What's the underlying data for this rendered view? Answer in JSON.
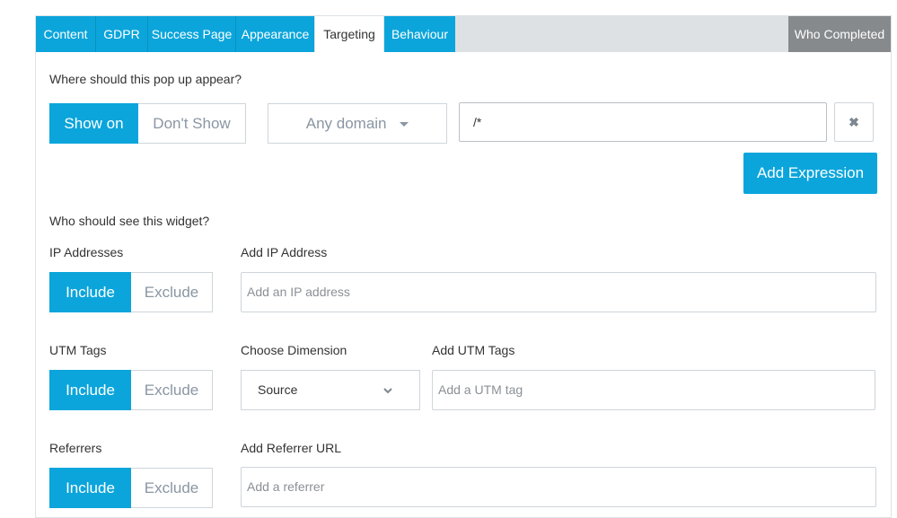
{
  "tabs": [
    {
      "label": "Content"
    },
    {
      "label": "GDPR"
    },
    {
      "label": "Success Page"
    },
    {
      "label": "Appearance"
    },
    {
      "label": "Targeting"
    },
    {
      "label": "Behaviour"
    }
  ],
  "active_tab": "Targeting",
  "who_completed": "Who Completed",
  "location": {
    "question": "Where should this pop up appear?",
    "show_on": "Show on",
    "dont_show": "Don't Show",
    "domain_select": "Any domain",
    "path_value": "/*",
    "remove_icon": "✖",
    "add_expression": "Add Expression"
  },
  "audience": {
    "question": "Who should see this widget?",
    "ip": {
      "label": "IP Addresses",
      "include": "Include",
      "exclude": "Exclude",
      "field_label": "Add IP Address",
      "placeholder": "Add an IP address"
    },
    "utm": {
      "label": "UTM Tags",
      "include": "Include",
      "exclude": "Exclude",
      "dimension_label": "Choose Dimension",
      "dimension_value": "Source",
      "field_label": "Add UTM Tags",
      "placeholder": "Add a UTM tag"
    },
    "referrers": {
      "label": "Referrers",
      "include": "Include",
      "exclude": "Exclude",
      "field_label": "Add Referrer URL",
      "placeholder": "Add a referrer"
    }
  },
  "colors": {
    "accent": "#0ba5db",
    "tab_bar": "#dde1e4",
    "who_completed_bg": "#868a8d"
  }
}
